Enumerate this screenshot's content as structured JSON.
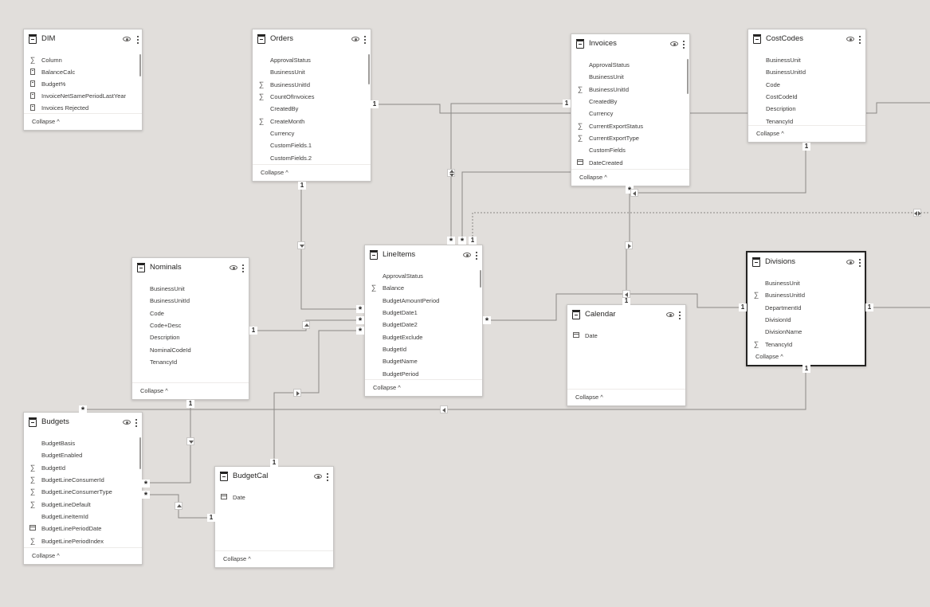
{
  "tables": {
    "dim": {
      "title": "DIM",
      "collapse": "Collapse ^",
      "fields": [
        {
          "name": "Column",
          "icon": "sigma"
        },
        {
          "name": "BalanceCalc",
          "icon": "calc"
        },
        {
          "name": "Budget%",
          "icon": "calc"
        },
        {
          "name": "InvoiceNetSamePeriodLastYear",
          "icon": "calc"
        },
        {
          "name": "Invoices Rejected",
          "icon": "calc"
        }
      ]
    },
    "orders": {
      "title": "Orders",
      "collapse": "Collapse ^",
      "fields": [
        {
          "name": "ApprovalStatus",
          "icon": ""
        },
        {
          "name": "BusinessUnit",
          "icon": ""
        },
        {
          "name": "BusinessUnitId",
          "icon": "sigma"
        },
        {
          "name": "CountOfInvoices",
          "icon": "sigma"
        },
        {
          "name": "CreatedBy",
          "icon": ""
        },
        {
          "name": "CreateMonth",
          "icon": "sigma"
        },
        {
          "name": "Currency",
          "icon": ""
        },
        {
          "name": "CustomFields.1",
          "icon": ""
        },
        {
          "name": "CustomFields.2",
          "icon": ""
        }
      ]
    },
    "invoices": {
      "title": "Invoices",
      "collapse": "Collapse ^",
      "fields": [
        {
          "name": "ApprovalStatus",
          "icon": ""
        },
        {
          "name": "BusinessUnit",
          "icon": ""
        },
        {
          "name": "BusinessUnitId",
          "icon": "sigma"
        },
        {
          "name": "CreatedBy",
          "icon": ""
        },
        {
          "name": "Currency",
          "icon": ""
        },
        {
          "name": "CurrentExportStatus",
          "icon": "sigma"
        },
        {
          "name": "CurrentExportType",
          "icon": "sigma"
        },
        {
          "name": "CustomFields",
          "icon": ""
        },
        {
          "name": "DateCreated",
          "icon": "date"
        }
      ]
    },
    "costcodes": {
      "title": "CostCodes",
      "collapse": "Collapse ^",
      "fields": [
        {
          "name": "BusinessUnit",
          "icon": ""
        },
        {
          "name": "BusinessUnitId",
          "icon": ""
        },
        {
          "name": "Code",
          "icon": ""
        },
        {
          "name": "CostCodeId",
          "icon": ""
        },
        {
          "name": "Description",
          "icon": ""
        },
        {
          "name": "TenancyId",
          "icon": ""
        }
      ]
    },
    "nominals": {
      "title": "Nominals",
      "collapse": "Collapse ^",
      "fields": [
        {
          "name": "BusinessUnit",
          "icon": ""
        },
        {
          "name": "BusinessUnitId",
          "icon": ""
        },
        {
          "name": "Code",
          "icon": ""
        },
        {
          "name": "Code+Desc",
          "icon": ""
        },
        {
          "name": "Description",
          "icon": ""
        },
        {
          "name": "NominalCodeId",
          "icon": ""
        },
        {
          "name": "TenancyId",
          "icon": ""
        }
      ]
    },
    "lineitems": {
      "title": "LineItems",
      "collapse": "Collapse ^",
      "fields": [
        {
          "name": "ApprovalStatus",
          "icon": ""
        },
        {
          "name": "Balance",
          "icon": "sigma"
        },
        {
          "name": "BudgetAmountPeriod",
          "icon": ""
        },
        {
          "name": "BudgetDate1",
          "icon": ""
        },
        {
          "name": "BudgetDate2",
          "icon": ""
        },
        {
          "name": "BudgetExclude",
          "icon": ""
        },
        {
          "name": "BudgetId",
          "icon": ""
        },
        {
          "name": "BudgetName",
          "icon": ""
        },
        {
          "name": "BudgetPeriod",
          "icon": ""
        }
      ]
    },
    "divisions": {
      "title": "Divisions",
      "collapse": "Collapse ^",
      "fields": [
        {
          "name": "BusinessUnit",
          "icon": ""
        },
        {
          "name": "BusinessUnitId",
          "icon": "sigma"
        },
        {
          "name": "DepartmentId",
          "icon": ""
        },
        {
          "name": "DivisionId",
          "icon": ""
        },
        {
          "name": "DivisionName",
          "icon": ""
        },
        {
          "name": "TenancyId",
          "icon": "sigma"
        }
      ]
    },
    "calendar": {
      "title": "Calendar",
      "collapse": "Collapse ^",
      "fields": [
        {
          "name": "Date",
          "icon": "date"
        }
      ]
    },
    "budgets": {
      "title": "Budgets",
      "collapse": "Collapse ^",
      "fields": [
        {
          "name": "BudgetBasis",
          "icon": ""
        },
        {
          "name": "BudgetEnabled",
          "icon": ""
        },
        {
          "name": "BudgetId",
          "icon": "sigma"
        },
        {
          "name": "BudgetLineConsumerId",
          "icon": "sigma"
        },
        {
          "name": "BudgetLineConsumerType",
          "icon": "sigma"
        },
        {
          "name": "BudgetLineDefault",
          "icon": "sigma"
        },
        {
          "name": "BudgetLineItemId",
          "icon": ""
        },
        {
          "name": "BudgetLinePeriodDate",
          "icon": "date"
        },
        {
          "name": "BudgetLinePeriodIndex",
          "icon": "sigma"
        }
      ]
    },
    "budgetcal": {
      "title": "BudgetCal",
      "collapse": "Collapse ^",
      "fields": [
        {
          "name": "Date",
          "icon": "date"
        }
      ]
    }
  },
  "relationship_marks": {
    "one": "1",
    "many": "*"
  }
}
